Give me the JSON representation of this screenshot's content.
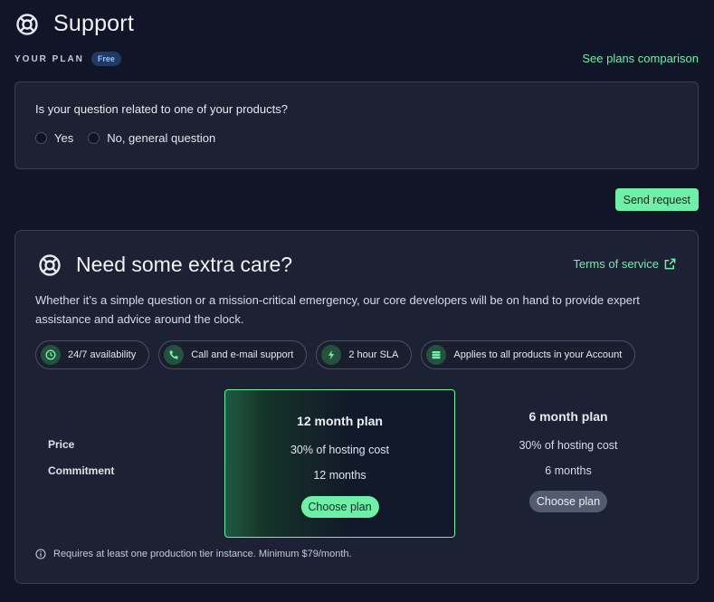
{
  "header": {
    "title": "Support",
    "icon": "lifebuoy-icon"
  },
  "plan": {
    "label": "YOUR PLAN",
    "badge": "Free",
    "compare_link": "See plans comparison"
  },
  "question": {
    "text": "Is your question related to one of your products?",
    "options": [
      "Yes",
      "No, general question"
    ]
  },
  "actions": {
    "send_label": "Send request"
  },
  "care": {
    "title": "Need some extra care?",
    "terms_link": "Terms of service",
    "description": "Whether it’s a simple question or a mission-critical emergency, our core developers will be on hand to provide expert assistance and advice around the clock.",
    "features": [
      {
        "label": "24/7 availability",
        "icon": "clock-icon"
      },
      {
        "label": "Call and e-mail support",
        "icon": "phone-icon"
      },
      {
        "label": "2 hour SLA",
        "icon": "lightning-icon"
      },
      {
        "label": "Applies to all products in your Account",
        "icon": "database-icon"
      }
    ],
    "row_labels": {
      "price": "Price",
      "commitment": "Commitment"
    },
    "plans": [
      {
        "title": "12 month plan",
        "price": "30% of hosting cost",
        "commitment": "12 months",
        "button": "Choose plan",
        "highlighted": true
      },
      {
        "title": "6 month plan",
        "price": "30% of hosting cost",
        "commitment": "6 months",
        "button": "Choose plan",
        "highlighted": false
      }
    ],
    "footnote": "Requires at least one production tier instance. Minimum $79/month."
  },
  "colors": {
    "accent": "#6ff0a8",
    "background": "#101527",
    "card": "#1c2133",
    "badge_bg": "#1f3a63"
  }
}
